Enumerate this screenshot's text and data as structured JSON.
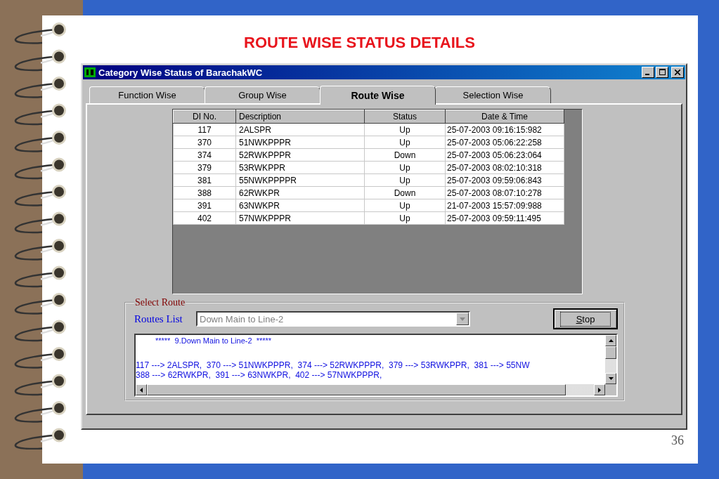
{
  "slide": {
    "title": "ROUTE WISE STATUS DETAILS",
    "page_number": "36"
  },
  "window": {
    "title": "Category Wise Status of BarachakWC"
  },
  "tabs": [
    {
      "label": "Function Wise",
      "selected": false
    },
    {
      "label": "Group Wise",
      "selected": false
    },
    {
      "label": "Route Wise",
      "selected": true
    },
    {
      "label": "Selection Wise",
      "selected": false
    }
  ],
  "table": {
    "columns": [
      "DI No.",
      "Description",
      "Status",
      "Date & Time"
    ],
    "rows": [
      [
        "117",
        "2ALSPR",
        "Up",
        "25-07-2003 09:16:15:982"
      ],
      [
        "370",
        "51NWKPPPR",
        "Up",
        "25-07-2003 05:06:22:258"
      ],
      [
        "374",
        "52RWKPPPR",
        "Down",
        "25-07-2003 05:06:23:064"
      ],
      [
        "379",
        "53RWKPPR",
        "Up",
        "25-07-2003 08:02:10:318"
      ],
      [
        "381",
        "55NWKPPPPR",
        "Up",
        "25-07-2003 09:59:06:843"
      ],
      [
        "388",
        "62RWKPR",
        "Down",
        "25-07-2003 08:07:10:278"
      ],
      [
        "391",
        "63NWKPR",
        "Up",
        "21-07-2003 15:57:09:988"
      ],
      [
        "402",
        "57NWKPPPR",
        "Up",
        "25-07-2003 09:59:11:495"
      ]
    ]
  },
  "select_route": {
    "legend": "Select Route",
    "routes_list_label": "Routes List",
    "routes_list": {
      "value": "Down Main to Line-2",
      "disabled": true
    },
    "stop_button": "Stop",
    "output": {
      "header": "*****  9.Down Main to Line-2  *****",
      "lines": [
        "117 ---> 2ALSPR,  370 ---> 51NWKPPPR,  374 ---> 52RWKPPPR,  379 ---> 53RWKPPR,  381 ---> 55NW",
        "388 ---> 62RWKPR,  391 ---> 63NWKPR,  402 ---> 57NWKPPPR,"
      ]
    }
  }
}
